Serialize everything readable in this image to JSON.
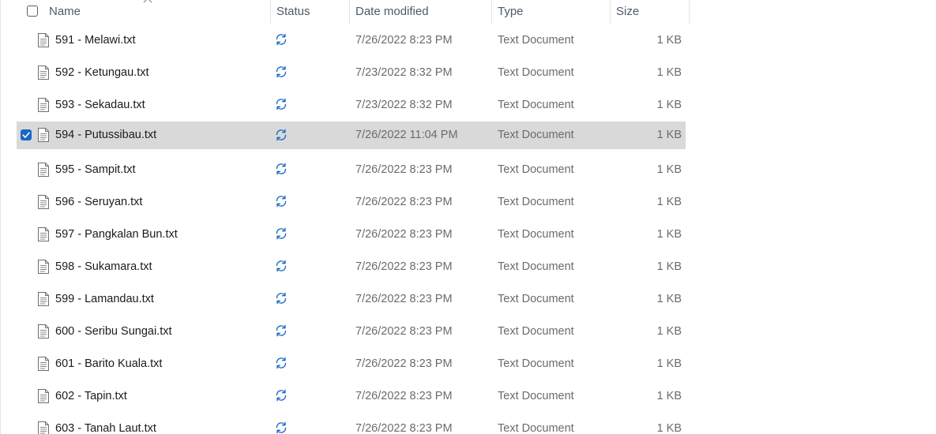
{
  "columns": {
    "name": "Name",
    "status": "Status",
    "date_modified": "Date modified",
    "type": "Type",
    "size": "Size"
  },
  "colors": {
    "accent": "#1a66c7",
    "sync_icon": "#1a66c7",
    "selected_row": "#d9d9d9"
  },
  "icons": {
    "file": "text-document-icon",
    "status": "sync-pending-icon",
    "sort": "chevron-up-icon"
  },
  "rows": [
    {
      "name": "591 - Melawi.txt",
      "date": "7/26/2022 8:23 PM",
      "type": "Text Document",
      "size": "1 KB",
      "selected": false
    },
    {
      "name": "592 - Ketungau.txt",
      "date": "7/23/2022 8:32 PM",
      "type": "Text Document",
      "size": "1 KB",
      "selected": false
    },
    {
      "name": "593 - Sekadau.txt",
      "date": "7/23/2022 8:32 PM",
      "type": "Text Document",
      "size": "1 KB",
      "selected": false
    },
    {
      "name": "594 - Putussibau.txt",
      "date": "7/26/2022 11:04 PM",
      "type": "Text Document",
      "size": "1 KB",
      "selected": true
    },
    {
      "name": "595 - Sampit.txt",
      "date": "7/26/2022 8:23 PM",
      "type": "Text Document",
      "size": "1 KB",
      "selected": false
    },
    {
      "name": "596 - Seruyan.txt",
      "date": "7/26/2022 8:23 PM",
      "type": "Text Document",
      "size": "1 KB",
      "selected": false
    },
    {
      "name": "597 - Pangkalan Bun.txt",
      "date": "7/26/2022 8:23 PM",
      "type": "Text Document",
      "size": "1 KB",
      "selected": false
    },
    {
      "name": "598 - Sukamara.txt",
      "date": "7/26/2022 8:23 PM",
      "type": "Text Document",
      "size": "1 KB",
      "selected": false
    },
    {
      "name": "599 - Lamandau.txt",
      "date": "7/26/2022 8:23 PM",
      "type": "Text Document",
      "size": "1 KB",
      "selected": false
    },
    {
      "name": "600 - Seribu Sungai.txt",
      "date": "7/26/2022 8:23 PM",
      "type": "Text Document",
      "size": "1 KB",
      "selected": false
    },
    {
      "name": "601 - Barito Kuala.txt",
      "date": "7/26/2022 8:23 PM",
      "type": "Text Document",
      "size": "1 KB",
      "selected": false
    },
    {
      "name": "602 - Tapin.txt",
      "date": "7/26/2022 8:23 PM",
      "type": "Text Document",
      "size": "1 KB",
      "selected": false
    },
    {
      "name": "603 - Tanah Laut.txt",
      "date": "7/26/2022 8:23 PM",
      "type": "Text Document",
      "size": "1 KB",
      "selected": false
    }
  ]
}
